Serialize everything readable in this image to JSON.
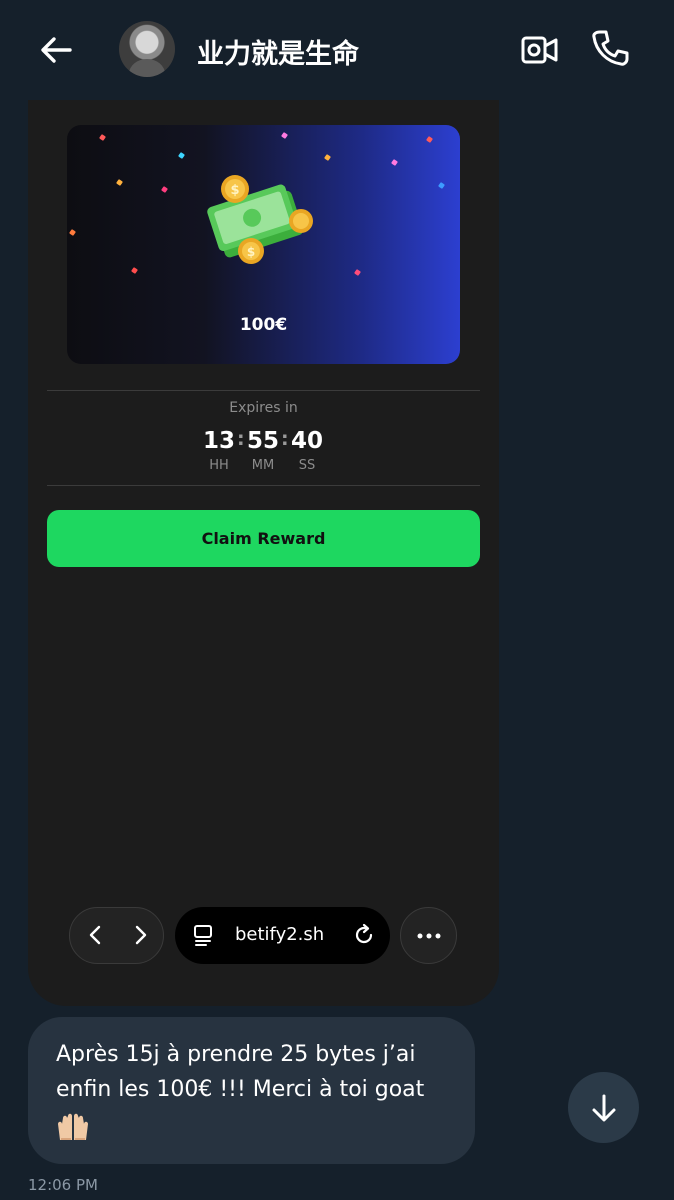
{
  "header": {
    "contact_name": "业力就是生命",
    "back_icon": "arrow-left-icon",
    "video_icon": "video-camera-icon",
    "call_icon": "phone-icon"
  },
  "promo": {
    "amount": "100€",
    "expires_label": "Expires in",
    "timer": {
      "hours": "13",
      "minutes": "55",
      "seconds": "40",
      "separator": ":",
      "hours_unit": "HH",
      "minutes_unit": "MM",
      "seconds_unit": "SS"
    },
    "claim_label": "Claim Reward",
    "claim_color": "#1ed760"
  },
  "browser": {
    "url": "betify2.sh",
    "back_icon": "chevron-left-icon",
    "forward_icon": "chevron-right-icon",
    "tabs_icon": "tabs-icon",
    "reload_icon": "reload-icon",
    "more_icon": "more-horizontal-icon"
  },
  "message": {
    "text": "Après 15j à prendre 25 bytes j’ai enfin les 100€ !!! Merci à toi goat",
    "emoji": "raised-hands-emoji",
    "timestamp": "12:06 PM"
  },
  "scroll_down_icon": "arrow-down-icon",
  "colors": {
    "background": "#15202b",
    "bubble": "#273340",
    "accent_green": "#1ed760"
  }
}
